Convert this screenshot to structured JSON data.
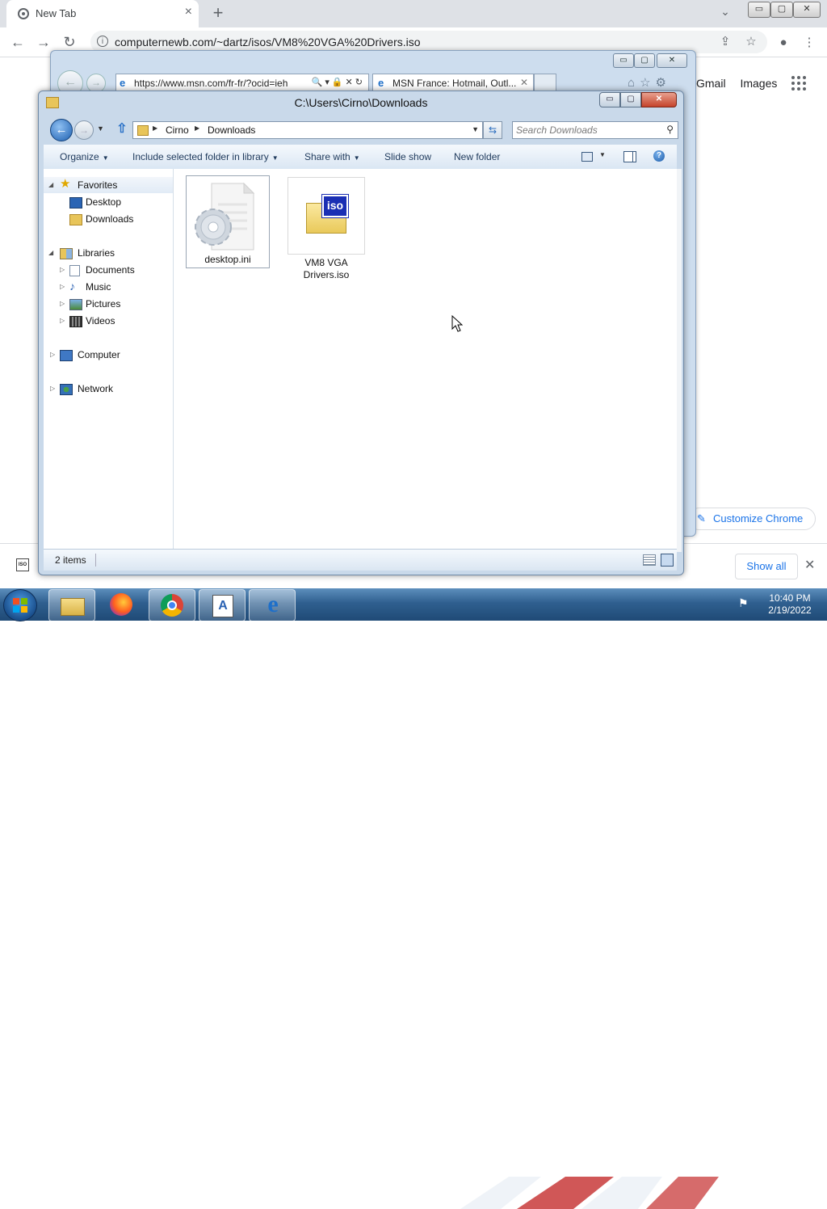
{
  "chrome": {
    "tab_title": "New Tab",
    "tab_close": "×",
    "new_tab": "+",
    "url": "computernewb.com/~dartz/isos/VM8%20VGA%20Drivers.iso",
    "window_minimize": "▭",
    "window_maximize": "▢",
    "window_close": "✕",
    "tab_search": "⌄",
    "links": [
      "Gmail",
      "Images"
    ],
    "customize_label": "Customize Chrome",
    "download_icon_text": "ISO",
    "show_all": "Show all",
    "close_bar": "✕"
  },
  "ie": {
    "url": "https://www.msn.com/fr-fr/?ocid=ieh",
    "addr_icons": "🔍▾🔒✕↻",
    "tab_title": "MSN France: Hotmail, Outl...",
    "tab_close": "✕"
  },
  "explorer": {
    "title": "C:\\Users\\Cirno\\Downloads",
    "breadcrumb": [
      "Cirno",
      "Downloads"
    ],
    "search_placeholder": "Search Downloads",
    "toolbar": {
      "organize": "Organize",
      "include": "Include selected folder in library",
      "share": "Share with",
      "slideshow": "Slide show",
      "newfolder": "New folder"
    },
    "nav": {
      "favorites": "Favorites",
      "desktop": "Desktop",
      "downloads": "Downloads",
      "libraries": "Libraries",
      "documents": "Documents",
      "music": "Music",
      "pictures": "Pictures",
      "videos": "Videos",
      "computer": "Computer",
      "network": "Network"
    },
    "files": [
      {
        "name": "desktop.ini"
      },
      {
        "name_line1": "VM8 VGA",
        "name_line2": "Drivers.iso",
        "icon_text": "iso"
      }
    ],
    "status": "2 items"
  },
  "taskbar": {
    "time": "10:40 PM",
    "date": "2/19/2022"
  },
  "colors": {
    "accent": "#1a73e8",
    "explorer_frame": "#c9d9ea",
    "taskbar": "#2f5f8f"
  }
}
